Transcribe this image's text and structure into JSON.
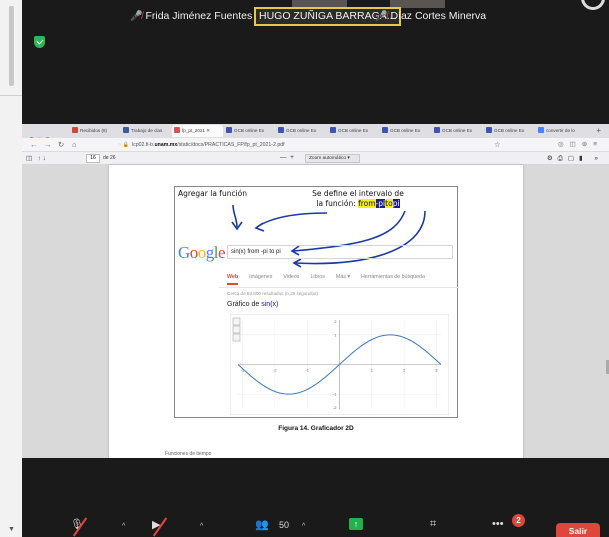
{
  "participants": [
    {
      "name": "Frida Jiménez Fuentes",
      "muted": true
    },
    {
      "name": "HUGO ZUÑIGA BARRAGA...",
      "active": true
    },
    {
      "name": "Díaz Cortes Minerva",
      "muted": true
    }
  ],
  "browser": {
    "tabs": [
      {
        "label": "Recibidos (6)",
        "icon_color": "#d44638"
      },
      {
        "label": "Trabajo de clas",
        "icon_color": "#3b5998"
      },
      {
        "label": "fp_pt_2021 ✕",
        "icon_color": "#d9534f",
        "active": true
      },
      {
        "label": "GCB online Ex",
        "icon_color": "#3a55b4"
      },
      {
        "label": "GCB online Ex",
        "icon_color": "#3a55b4"
      },
      {
        "label": "GCB online Ex",
        "icon_color": "#3a55b4"
      },
      {
        "label": "GCB online Ex",
        "icon_color": "#3a55b4"
      },
      {
        "label": "GCB online Ex",
        "icon_color": "#3a55b4"
      },
      {
        "label": "GCB online Ex",
        "icon_color": "#3a55b4"
      },
      {
        "label": "convertir de lo",
        "icon_color": "#4285f4"
      }
    ],
    "new_tab": "+",
    "url_prefix": "lcp02.fi-b.",
    "url_domain": "unam.mx",
    "url_path": "/static/docs/PRACTICAS_FP/fp_pt_2021-2.pdf",
    "page_number": "16",
    "page_of": "de 26",
    "zoom_minus": "—",
    "zoom_plus": "+",
    "zoom_mode": "Zoom automático"
  },
  "figure": {
    "annotation_left": "Agregar la función",
    "annotation_right_line1": "Se define el intervalo de",
    "annotation_right_prefix": "la función:",
    "from": "from",
    "minus_pi": "-pi",
    "to": "to",
    "pi": "pi",
    "google_logo": [
      "G",
      "o",
      "o",
      "g",
      "l",
      "e"
    ],
    "search_query": "sin(x) from -pi to pi",
    "search_tabs": [
      "Web",
      "Imágenes",
      "Videos",
      "Libros",
      "Más ▾",
      "Herramientas de búsqueda"
    ],
    "result_count": "Cerca de 63.800 resultados (0,28 segundos)",
    "graph_title_prefix": "Gráfico de",
    "graph_title_fn": "sin(x)",
    "caption": "Figura 14. Graficador 2D",
    "page_fragment": "Funciones de tiempo"
  },
  "chart_data": {
    "type": "line",
    "title": "Gráfico de sin(x)",
    "series": [
      {
        "name": "sin(x)",
        "function": "sin(x)"
      }
    ],
    "xlim": [
      -3.14159,
      3.14159
    ],
    "ylim": [
      -1.5,
      1.5
    ],
    "xticks": [
      "-3",
      "-2",
      "-1",
      "1",
      "2",
      "3"
    ],
    "yticks": [
      "2",
      "1",
      "-1",
      "-2"
    ],
    "grid": true
  },
  "toolbar": {
    "participants_count": "50",
    "chat_badge": "2",
    "leave_label": "Salir",
    "accent_red": "#e0463a",
    "accent_green": "#22b24c"
  }
}
